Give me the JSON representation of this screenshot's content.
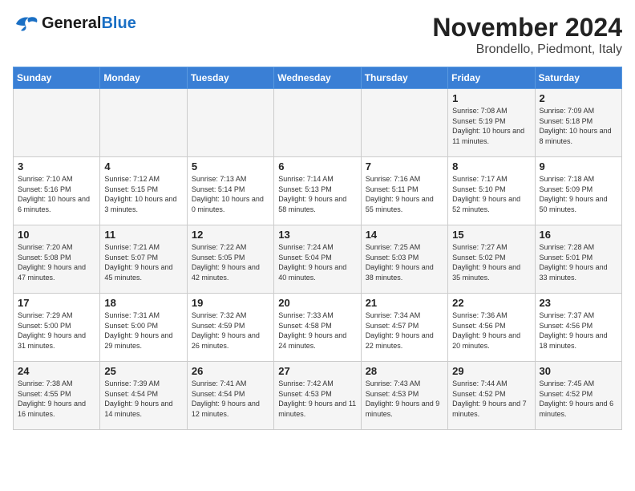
{
  "logo": {
    "line1": "General",
    "line2": "Blue"
  },
  "header": {
    "month": "November 2024",
    "location": "Brondello, Piedmont, Italy"
  },
  "weekdays": [
    "Sunday",
    "Monday",
    "Tuesday",
    "Wednesday",
    "Thursday",
    "Friday",
    "Saturday"
  ],
  "weeks": [
    [
      {
        "day": "",
        "info": ""
      },
      {
        "day": "",
        "info": ""
      },
      {
        "day": "",
        "info": ""
      },
      {
        "day": "",
        "info": ""
      },
      {
        "day": "",
        "info": ""
      },
      {
        "day": "1",
        "info": "Sunrise: 7:08 AM\nSunset: 5:19 PM\nDaylight: 10 hours and 11 minutes."
      },
      {
        "day": "2",
        "info": "Sunrise: 7:09 AM\nSunset: 5:18 PM\nDaylight: 10 hours and 8 minutes."
      }
    ],
    [
      {
        "day": "3",
        "info": "Sunrise: 7:10 AM\nSunset: 5:16 PM\nDaylight: 10 hours and 6 minutes."
      },
      {
        "day": "4",
        "info": "Sunrise: 7:12 AM\nSunset: 5:15 PM\nDaylight: 10 hours and 3 minutes."
      },
      {
        "day": "5",
        "info": "Sunrise: 7:13 AM\nSunset: 5:14 PM\nDaylight: 10 hours and 0 minutes."
      },
      {
        "day": "6",
        "info": "Sunrise: 7:14 AM\nSunset: 5:13 PM\nDaylight: 9 hours and 58 minutes."
      },
      {
        "day": "7",
        "info": "Sunrise: 7:16 AM\nSunset: 5:11 PM\nDaylight: 9 hours and 55 minutes."
      },
      {
        "day": "8",
        "info": "Sunrise: 7:17 AM\nSunset: 5:10 PM\nDaylight: 9 hours and 52 minutes."
      },
      {
        "day": "9",
        "info": "Sunrise: 7:18 AM\nSunset: 5:09 PM\nDaylight: 9 hours and 50 minutes."
      }
    ],
    [
      {
        "day": "10",
        "info": "Sunrise: 7:20 AM\nSunset: 5:08 PM\nDaylight: 9 hours and 47 minutes."
      },
      {
        "day": "11",
        "info": "Sunrise: 7:21 AM\nSunset: 5:07 PM\nDaylight: 9 hours and 45 minutes."
      },
      {
        "day": "12",
        "info": "Sunrise: 7:22 AM\nSunset: 5:05 PM\nDaylight: 9 hours and 42 minutes."
      },
      {
        "day": "13",
        "info": "Sunrise: 7:24 AM\nSunset: 5:04 PM\nDaylight: 9 hours and 40 minutes."
      },
      {
        "day": "14",
        "info": "Sunrise: 7:25 AM\nSunset: 5:03 PM\nDaylight: 9 hours and 38 minutes."
      },
      {
        "day": "15",
        "info": "Sunrise: 7:27 AM\nSunset: 5:02 PM\nDaylight: 9 hours and 35 minutes."
      },
      {
        "day": "16",
        "info": "Sunrise: 7:28 AM\nSunset: 5:01 PM\nDaylight: 9 hours and 33 minutes."
      }
    ],
    [
      {
        "day": "17",
        "info": "Sunrise: 7:29 AM\nSunset: 5:00 PM\nDaylight: 9 hours and 31 minutes."
      },
      {
        "day": "18",
        "info": "Sunrise: 7:31 AM\nSunset: 5:00 PM\nDaylight: 9 hours and 29 minutes."
      },
      {
        "day": "19",
        "info": "Sunrise: 7:32 AM\nSunset: 4:59 PM\nDaylight: 9 hours and 26 minutes."
      },
      {
        "day": "20",
        "info": "Sunrise: 7:33 AM\nSunset: 4:58 PM\nDaylight: 9 hours and 24 minutes."
      },
      {
        "day": "21",
        "info": "Sunrise: 7:34 AM\nSunset: 4:57 PM\nDaylight: 9 hours and 22 minutes."
      },
      {
        "day": "22",
        "info": "Sunrise: 7:36 AM\nSunset: 4:56 PM\nDaylight: 9 hours and 20 minutes."
      },
      {
        "day": "23",
        "info": "Sunrise: 7:37 AM\nSunset: 4:56 PM\nDaylight: 9 hours and 18 minutes."
      }
    ],
    [
      {
        "day": "24",
        "info": "Sunrise: 7:38 AM\nSunset: 4:55 PM\nDaylight: 9 hours and 16 minutes."
      },
      {
        "day": "25",
        "info": "Sunrise: 7:39 AM\nSunset: 4:54 PM\nDaylight: 9 hours and 14 minutes."
      },
      {
        "day": "26",
        "info": "Sunrise: 7:41 AM\nSunset: 4:54 PM\nDaylight: 9 hours and 12 minutes."
      },
      {
        "day": "27",
        "info": "Sunrise: 7:42 AM\nSunset: 4:53 PM\nDaylight: 9 hours and 11 minutes."
      },
      {
        "day": "28",
        "info": "Sunrise: 7:43 AM\nSunset: 4:53 PM\nDaylight: 9 hours and 9 minutes."
      },
      {
        "day": "29",
        "info": "Sunrise: 7:44 AM\nSunset: 4:52 PM\nDaylight: 9 hours and 7 minutes."
      },
      {
        "day": "30",
        "info": "Sunrise: 7:45 AM\nSunset: 4:52 PM\nDaylight: 9 hours and 6 minutes."
      }
    ]
  ]
}
